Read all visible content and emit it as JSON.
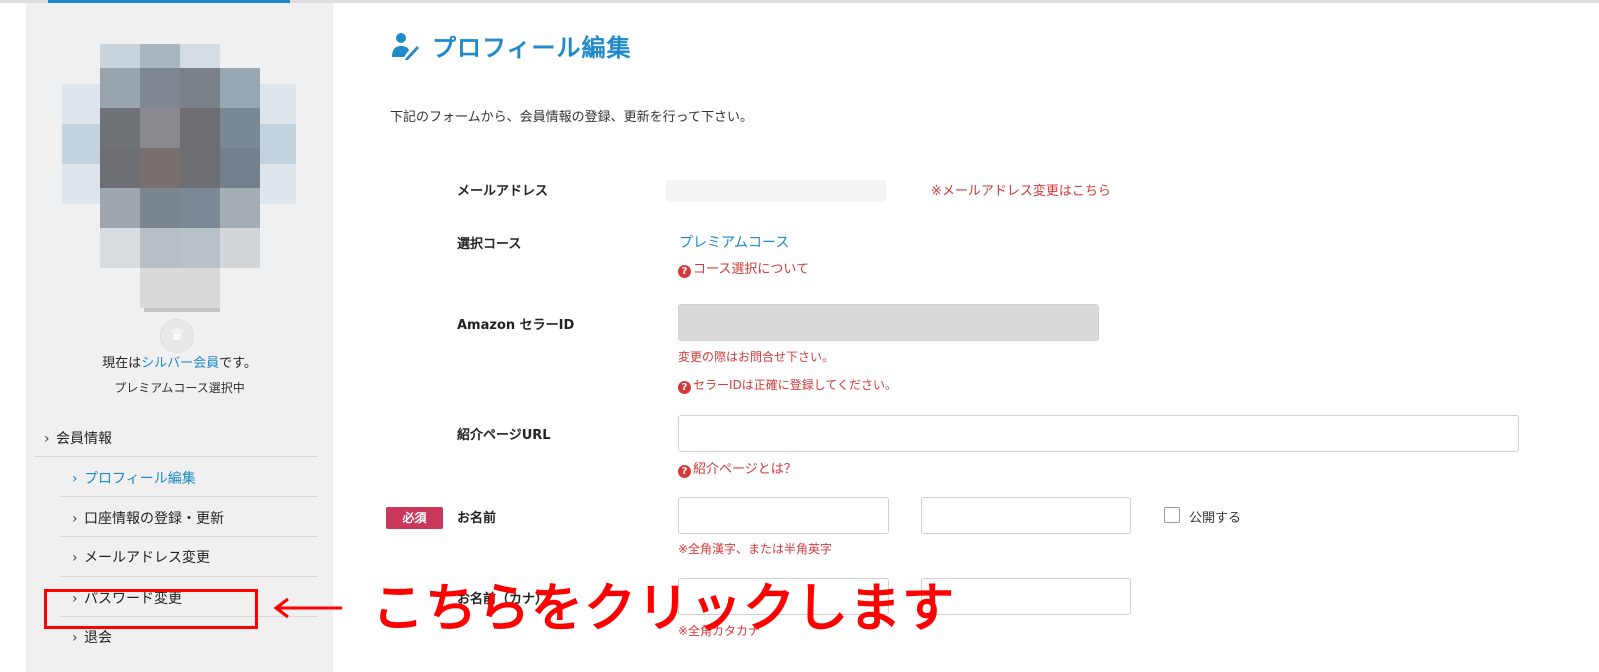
{
  "sidebar": {
    "member_prefix": "現在は",
    "member_level": "シルバー会員",
    "member_suffix": "です。",
    "course_status": "プレミアムコース選択中",
    "nav": {
      "member_info": "会員情報",
      "profile_edit": "プロフィール編集",
      "bank_register": "口座情報の登録・更新",
      "email_change": "メールアドレス変更",
      "password_change": "パスワード変更",
      "withdraw": "退会"
    }
  },
  "main": {
    "title": "プロフィール編集",
    "intro": "下記のフォームから、会員情報の登録、更新を行って下さい。",
    "email": {
      "label": "メールアドレス",
      "change_link": "※メールアドレス変更はこちら"
    },
    "course": {
      "label": "選択コース",
      "value": "プレミアムコース",
      "help": "コース選択について"
    },
    "seller_id": {
      "label": "Amazon セラーID",
      "note": "変更の際はお問合せ下さい。",
      "help": "セラーIDは正確に登録してください。"
    },
    "referral": {
      "label": "紹介ページURL",
      "help": "紹介ページとは？"
    },
    "name": {
      "required_badge": "必須",
      "label": "お名前",
      "public_label": "公開する",
      "note": "※全角漢字、または半角英字"
    },
    "kana": {
      "label": "お名前（カナ）",
      "note": "※全角カタカナ"
    }
  },
  "annotation": {
    "text": "こちらをクリックします"
  },
  "colors": {
    "accent_blue": "#1f8ac9",
    "alert_red": "#d43a3a",
    "annotation_red": "#ff0000",
    "required_badge": "#c9385a",
    "sidebar_bg": "#f0f0f0"
  }
}
